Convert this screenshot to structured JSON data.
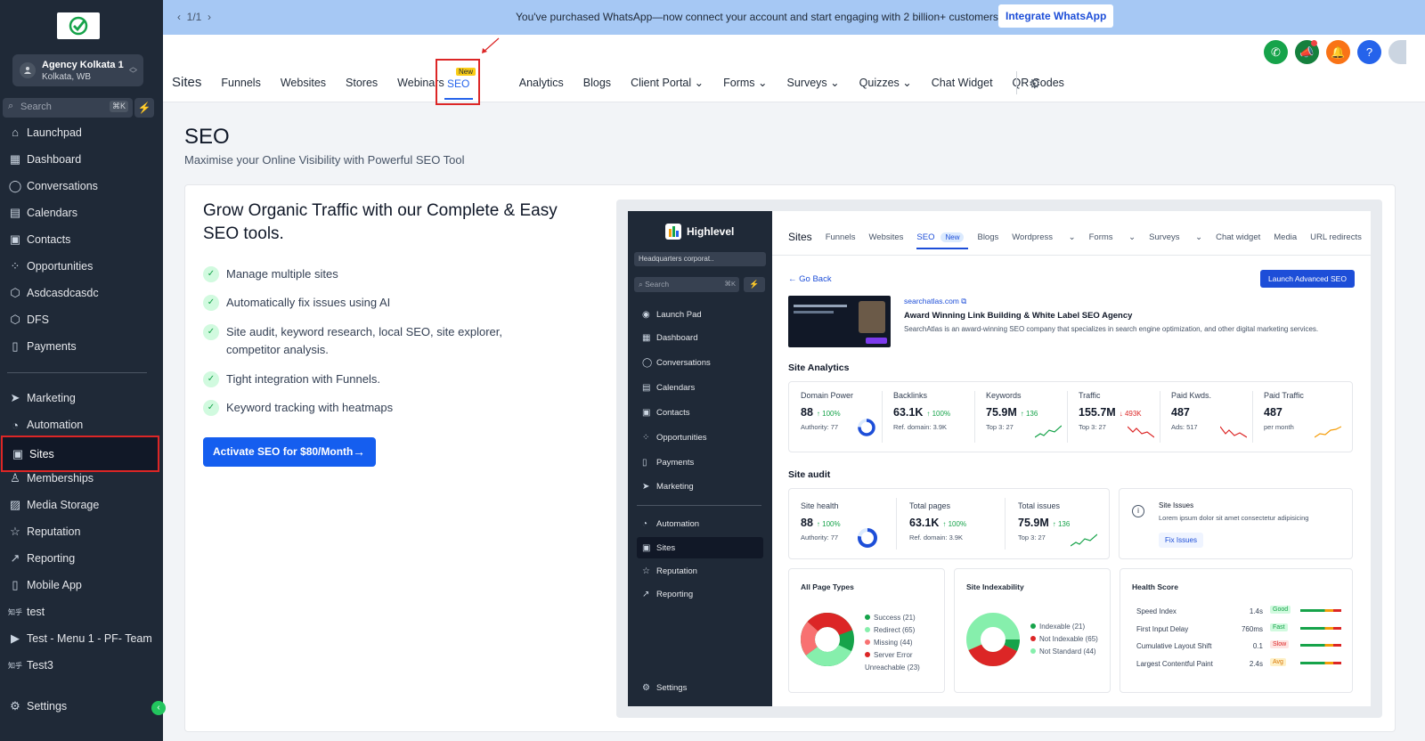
{
  "banner": {
    "pagination": "1/1",
    "message": "You've purchased WhatsApp—now connect your account and start engaging with 2 billion+ customers!",
    "button": "Integrate WhatsApp"
  },
  "sidebar": {
    "account": {
      "name": "Agency Kolkata 1",
      "location": "Kolkata, WB"
    },
    "search": {
      "placeholder": "Search",
      "shortcut": "⌘K"
    },
    "partial_item": "Launchpad",
    "items_top": [
      "Dashboard",
      "Conversations",
      "Calendars",
      "Contacts",
      "Opportunities",
      "Asdcasdcasdc",
      "DFS",
      "Payments"
    ],
    "items_bottom": [
      "Marketing",
      "Automation",
      "Sites",
      "Memberships",
      "Media Storage",
      "Reputation",
      "Reporting",
      "Mobile App",
      "test",
      "Test - Menu 1 - PF- Team",
      "Test3"
    ],
    "settings": "Settings",
    "active": "Sites"
  },
  "header": {
    "tabs": {
      "sites": "Sites",
      "funnels": "Funnels",
      "websites": "Websites",
      "stores": "Stores",
      "webinars": "Webinars",
      "seo": "SEO",
      "seo_badge": "New",
      "analytics": "Analytics",
      "blogs": "Blogs",
      "client_portal": "Client Portal",
      "forms": "Forms",
      "surveys": "Surveys",
      "quizzes": "Quizzes",
      "chat_widget": "Chat Widget",
      "qr_codes": "QR Codes"
    },
    "icon_colors": {
      "phone": "#16a34a",
      "megaphone": "#15803d",
      "bell": "#f97316",
      "help": "#2563eb"
    }
  },
  "main": {
    "title": "SEO",
    "subtitle": "Maximise your Online Visibility with Powerful SEO Tool",
    "heading": "Grow Organic Traffic with our Complete & Easy SEO tools.",
    "features": [
      "Manage multiple sites",
      "Automatically fix issues using AI",
      "Site audit, keyword research, local SEO, site explorer, competitor analysis.",
      "Tight integration with Funnels.",
      "Keyword tracking with heatmaps"
    ],
    "cta": "Activate SEO for $80/Month"
  },
  "preview": {
    "brand": "Highlevel",
    "account": "Headquarters corporat..",
    "search": "Search",
    "shortcut": "⌘K",
    "nav": [
      "Launch Pad",
      "Dashboard",
      "Conversations",
      "Calendars",
      "Contacts",
      "Opportunities",
      "Payments",
      "Marketing"
    ],
    "nav2": [
      "Automation",
      "Sites",
      "Reputation",
      "Reporting"
    ],
    "settings": "Settings",
    "tabs": {
      "sites": "Sites",
      "funnels": "Funnels",
      "websites": "Websites",
      "seo": "SEO",
      "new": "New",
      "blogs": "Blogs",
      "wordpress": "Wordpress",
      "forms": "Forms",
      "surveys": "Surveys",
      "chat": "Chat widget",
      "media": "Media",
      "url": "URL redirects"
    },
    "go_back": "Go Back",
    "launch": "Launch Advanced SEO",
    "site_url": "searchatlas.com",
    "site_title": "Award Winning Link Building & White Label SEO Agency",
    "site_desc": "SearchAtlas is an award-winning SEO company that specializes in search engine optimization, and other digital marketing services.",
    "analytics_title": "Site Analytics",
    "analytics": [
      {
        "label": "Domain Power",
        "value": "88",
        "change": "100%",
        "dir": "up",
        "sub": "Authority: 77"
      },
      {
        "label": "Backlinks",
        "value": "63.1K",
        "change": "100%",
        "dir": "up",
        "sub": "Ref. domain: 3.9K"
      },
      {
        "label": "Keywords",
        "value": "75.9M",
        "change": "136",
        "dir": "up",
        "sub": "Top 3: 27"
      },
      {
        "label": "Traffic",
        "value": "155.7M",
        "change": "493K",
        "dir": "down",
        "sub": "Top 3: 27"
      },
      {
        "label": "Paid Kwds.",
        "value": "487",
        "change": "",
        "dir": "",
        "sub": "Ads: 517"
      },
      {
        "label": "Paid Traffic",
        "value": "487",
        "change": "",
        "dir": "",
        "sub": "per month"
      }
    ],
    "audit_title": "Site audit",
    "audit": [
      {
        "label": "Site health",
        "value": "88",
        "change": "100%",
        "sub": "Authority: 77"
      },
      {
        "label": "Total pages",
        "value": "63.1K",
        "change": "100%",
        "sub": "Ref. domain: 3.9K"
      },
      {
        "label": "Total issues",
        "value": "75.9M",
        "change": "136",
        "sub": "Top 3: 27"
      }
    ],
    "issues": {
      "title": "Site Issues",
      "text": "Lorem ipsum dolor sit amet consectetur adipisicing",
      "button": "Fix Issues"
    },
    "page_types": {
      "title": "All Page Types",
      "legend": [
        "Success (21)",
        "Redirect (65)",
        "Missing (44)",
        "Server Error Unreachable (23)"
      ]
    },
    "indexability": {
      "title": "Site Indexability",
      "legend": [
        "Indexable (21)",
        "Not Indexable (65)",
        "Not Standard (44)"
      ]
    },
    "health": {
      "title": "Health Score",
      "rows": [
        {
          "label": "Speed Index",
          "value": "1.4s",
          "tag": "Good"
        },
        {
          "label": "First Input Delay",
          "value": "760ms",
          "tag": "Fast"
        },
        {
          "label": "Cumulative Layout Shift",
          "value": "0.1",
          "tag": "Slow"
        },
        {
          "label": "Largest Contentful Paint",
          "value": "2.4s",
          "tag": "Avg"
        }
      ]
    }
  }
}
